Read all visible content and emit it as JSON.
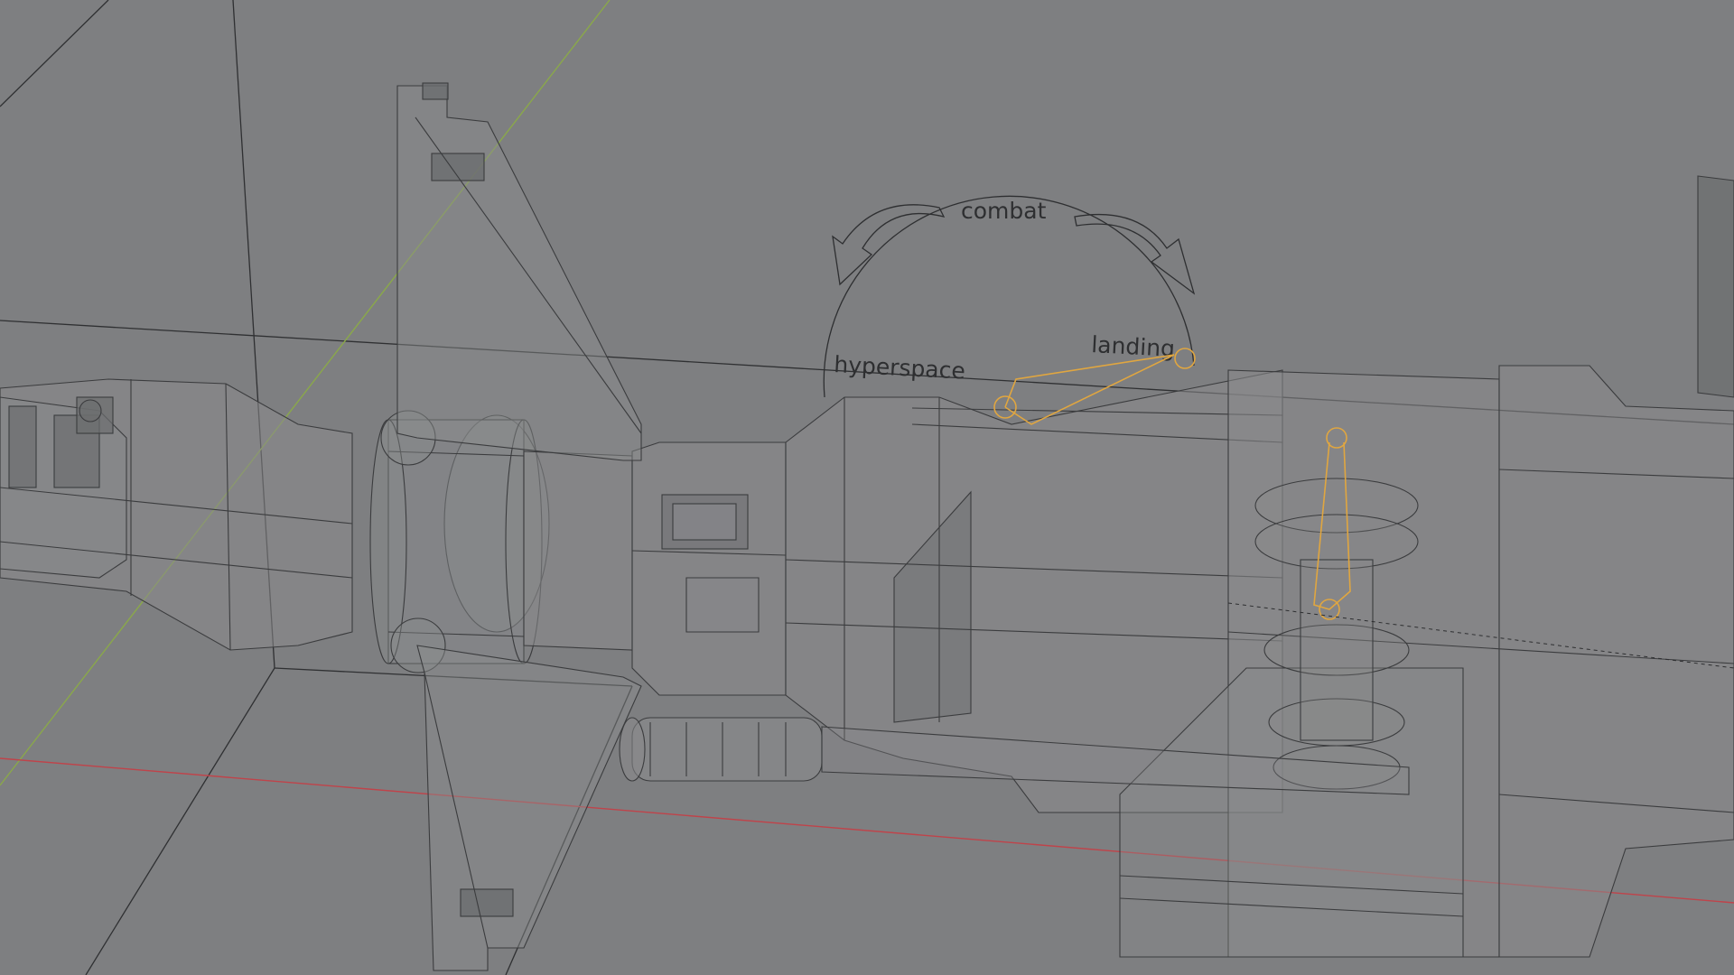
{
  "viewport": {
    "background": "#7e7f81",
    "wire_color": "#3b3c3e",
    "x_axis_color": "#c0434a",
    "y_axis_color": "#8aa84a",
    "rig_color": "#e0a640",
    "annotation": {
      "labels": {
        "top": "combat",
        "left": "hyperspace",
        "right": "landing"
      }
    }
  }
}
